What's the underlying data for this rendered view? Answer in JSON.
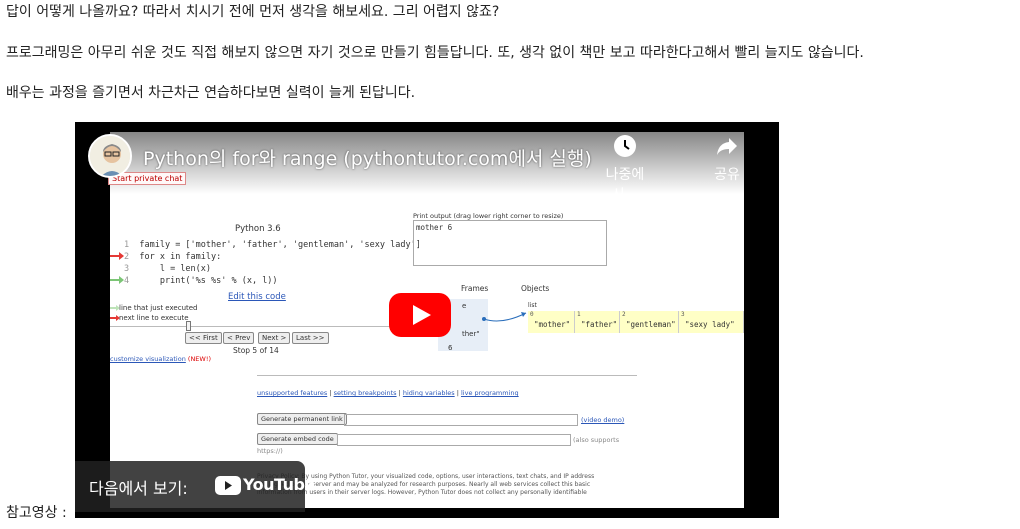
{
  "paragraphs": [
    "답이 어떻게 나올까요? 따라서 치시기 전에 먼저 생각을 해보세요. 그리 어렵지 않죠?",
    "프로그래밍은 아무리 쉬운 것도 직접 해보지 않으면 자기 것으로 만들기 힘들답니다. 또, 생각 없이 책만 보고 따라한다고해서 빨리 늘지도 않습니다.",
    "배우는 과정을 즐기면서 차근차근 연습하다보면 실력이 늘게 된답니다."
  ],
  "caption": "참고영상 :",
  "video": {
    "title": "Python의 for와 range (pythontutor.com에서 실행)",
    "watch_later": "나중에 시...",
    "share": "공유",
    "watch_on": "다음에서 보기:",
    "youtube_word": "YouTube",
    "private_chat": "Start private chat",
    "tutor": {
      "language": "Python 3.6",
      "code": [
        {
          "num": "1",
          "text": "family = ['mother', 'father', 'gentleman', 'sexy lady']"
        },
        {
          "num": "2",
          "text": "for x in family:"
        },
        {
          "num": "3",
          "text": "    l = len(x)"
        },
        {
          "num": "4",
          "text": "    print('%s %s' % (x, l))"
        }
      ],
      "edit_link": "Edit this code",
      "legend_executed": "line that just executed",
      "legend_next": "next line to execute",
      "buttons": {
        "first": "<< First",
        "prev": "< Prev",
        "next": "Next >",
        "last": "Last >>"
      },
      "step": "Stop 5 of 14",
      "customize": "customize visualization",
      "new_badge": "(NEW!)",
      "print_output_label": "Print output (drag lower right corner to resize)",
      "print_output": "mother 6",
      "frames_label": "Frames",
      "objects_label": "Objects",
      "frame_var_partial": "e",
      "frame_value_partial": "ther\"",
      "frame_num": "6",
      "list_label": "list",
      "list_items": [
        {
          "idx": "0",
          "value": "\"mother\""
        },
        {
          "idx": "1",
          "value": "\"father\""
        },
        {
          "idx": "2",
          "value": "\"gentleman\""
        },
        {
          "idx": "3",
          "value": "\"sexy lady\""
        }
      ],
      "links": [
        "unsupported features",
        "setting breakpoints",
        "hiding variables",
        "live programming"
      ],
      "gen_permanent": "Generate permanent link",
      "video_demo": "(video demo)",
      "gen_embed": "Generate embed code",
      "also_supports": "(also supports",
      "https_note": "https://)",
      "privacy_1": "Privacy Policy: By using Python Tutor, your visualized code, options, user interactions, text chats, and IP address",
      "privacy_2": "are logged on our server and may be analyzed for research purposes. Nearly all web services collect this basic",
      "privacy_3": "information from users in their server logs. However, Python Tutor does not collect any personally identifiable"
    }
  },
  "colors": {
    "yt_red": "#ff0000",
    "list_bg": "#ffffc6",
    "link": "#2b57b8",
    "arrow_red": "#e53935",
    "arrow_green": "#7cc576"
  }
}
